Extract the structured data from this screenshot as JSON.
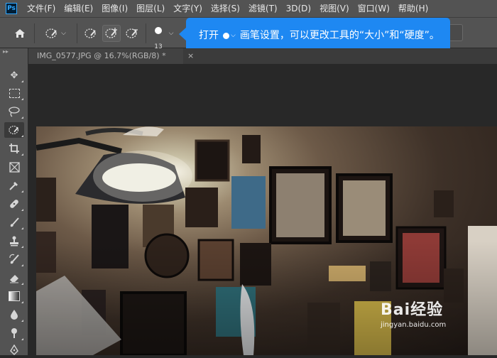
{
  "app": {
    "logo": "Ps"
  },
  "menu": [
    "文件(F)",
    "编辑(E)",
    "图像(I)",
    "图层(L)",
    "文字(Y)",
    "选择(S)",
    "滤镜(T)",
    "3D(D)",
    "视图(V)",
    "窗口(W)",
    "帮助(H)"
  ],
  "options": {
    "brush_size": "13"
  },
  "tooltip": {
    "text_before": "打开",
    "text_after": "画笔设置，可以更改工具的“大小”和“硬度”。"
  },
  "document_tab": {
    "title": "IMG_0577.JPG @ 16.7%(RGB/8) *",
    "close": "×"
  },
  "watermark": {
    "brand": "Bai经验",
    "url": "jingyan.baidu.com"
  },
  "tools": [
    "move-tool",
    "marquee-tool",
    "lasso-tool",
    "quick-selection-tool",
    "crop-tool",
    "frame-tool",
    "eyedropper-tool",
    "healing-brush-tool",
    "brush-tool",
    "clone-stamp-tool",
    "history-brush-tool",
    "eraser-tool",
    "gradient-tool",
    "blur-tool",
    "dodge-tool",
    "pen-tool"
  ]
}
